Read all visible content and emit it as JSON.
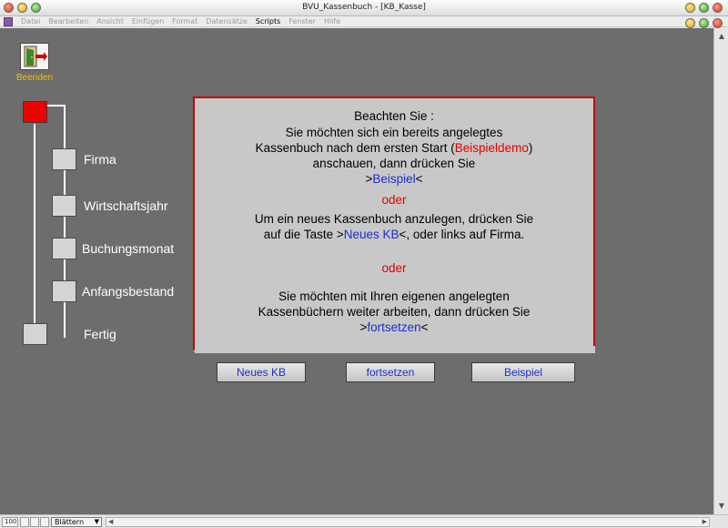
{
  "window": {
    "title": "BVU_Kassenbuch - [KB_Kasse]"
  },
  "menu": {
    "items": [
      "Datei",
      "Bearbeiten",
      "Ansicht",
      "Einfügen",
      "Format",
      "Datensätze",
      "Scripts",
      "Fenster",
      "Hilfe"
    ],
    "active_item": "Scripts"
  },
  "exit": {
    "label": "Beenden",
    "icon": "exit-door-icon"
  },
  "steps": {
    "firma": "Firma",
    "wirtschaftsjahr": "Wirtschaftsjahr",
    "buchungsmonat": "Buchungsmonat",
    "anfangsbestand": "Anfangsbestand",
    "fertig": "Fertig"
  },
  "notice": {
    "heading": "Beachten Sie :",
    "p1_line1": "Sie möchten sich ein bereits angelegtes",
    "p1_line2_pre": "Kassenbuch nach dem ersten Start (",
    "p1_line2_highlight": "Beispieldemo",
    "p1_line2_post": ")",
    "p1_line3": "anschauen, dann drücken Sie",
    "p1_line4_pre": ">",
    "p1_line4_highlight": "Beispiel",
    "p1_line4_post": "<",
    "or1": "oder",
    "p2_line1": "Um ein neues Kassenbuch anzulegen, drücken Sie",
    "p2_line2_pre": "auf die Taste >",
    "p2_line2_highlight": "Neues KB",
    "p2_line2_post": "<, oder links auf Firma.",
    "or2": "oder",
    "p3_line1": "Sie möchten mit Ihren eigenen angelegten",
    "p3_line2": "Kassenbüchern weiter arbeiten, dann drücken Sie",
    "p3_line3_pre": ">",
    "p3_line3_highlight": "fortsetzen",
    "p3_line3_post": "<"
  },
  "buttons": {
    "new_kb": "Neues KB",
    "continue": "fortsetzen",
    "example": "Beispiel"
  },
  "statusbar": {
    "zoom": "100",
    "mode": "Blättern"
  },
  "colors": {
    "background": "#6d6d6d",
    "panel": "#c8c8c8",
    "accent_red": "#e00000",
    "accent_blue": "#1a2fc8",
    "beenden_label": "#f0c000"
  }
}
